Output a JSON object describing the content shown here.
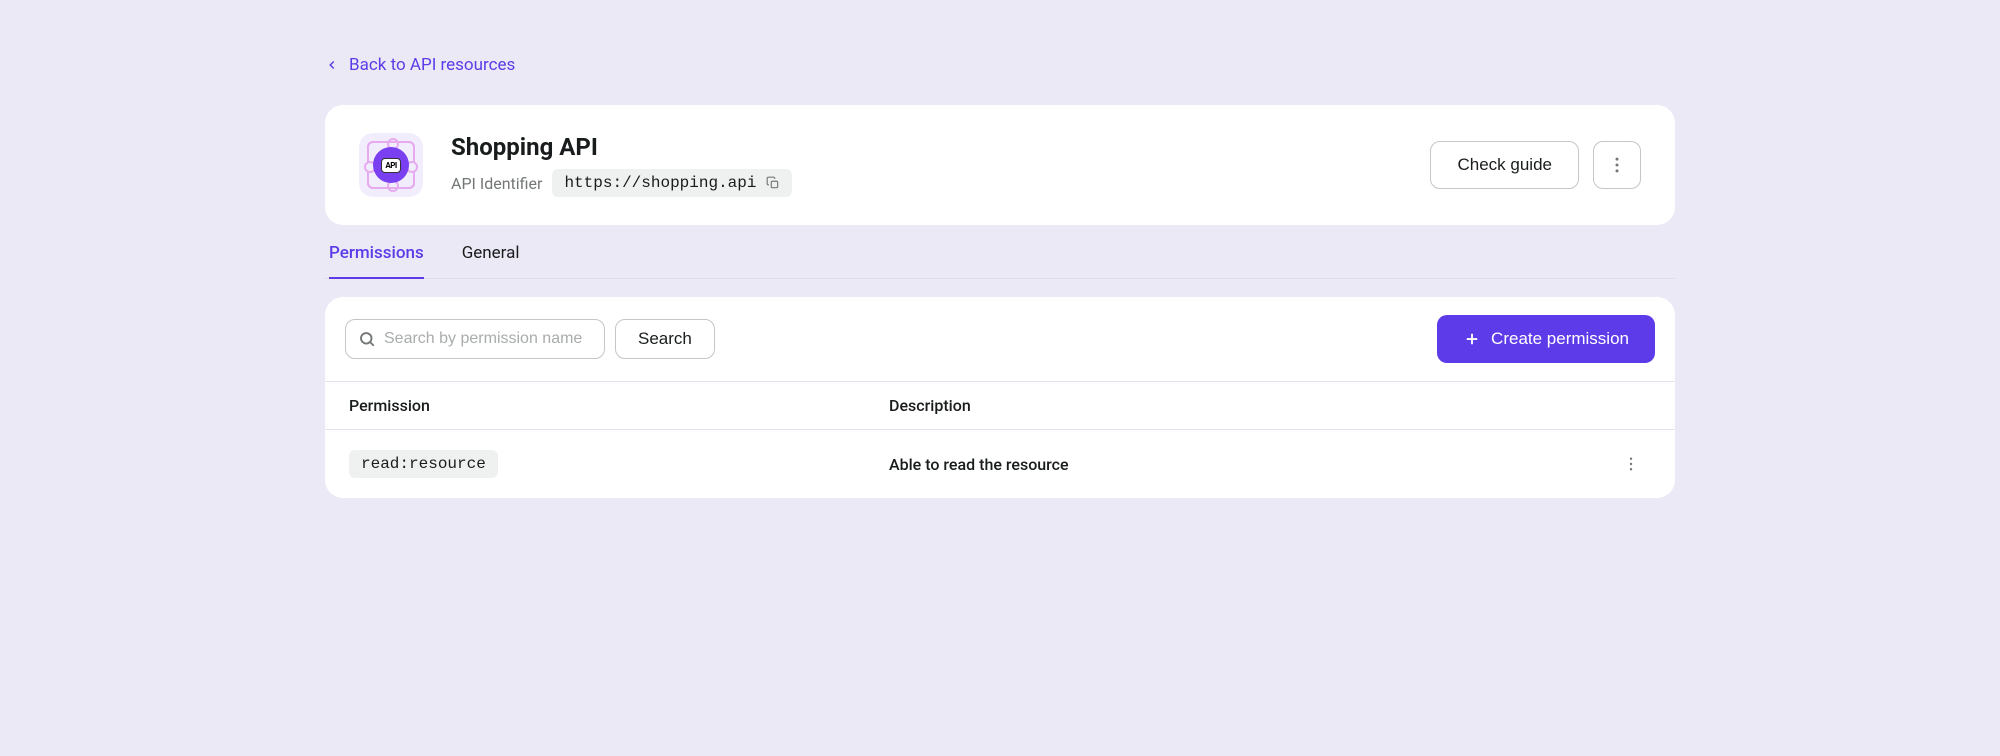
{
  "back_link": {
    "label": "Back to API resources"
  },
  "header": {
    "title": "Shopping API",
    "identifier_label": "API Identifier",
    "identifier_value": "https://shopping.api",
    "icon_badge": "API",
    "check_guide_label": "Check guide"
  },
  "tabs": [
    {
      "label": "Permissions",
      "active": true
    },
    {
      "label": "General",
      "active": false
    }
  ],
  "toolbar": {
    "search_placeholder": "Search by permission name",
    "search_button": "Search",
    "create_button": "Create permission"
  },
  "table": {
    "columns": {
      "permission": "Permission",
      "description": "Description"
    },
    "rows": [
      {
        "permission": "read:resource",
        "description": "Able to read the resource"
      }
    ]
  }
}
